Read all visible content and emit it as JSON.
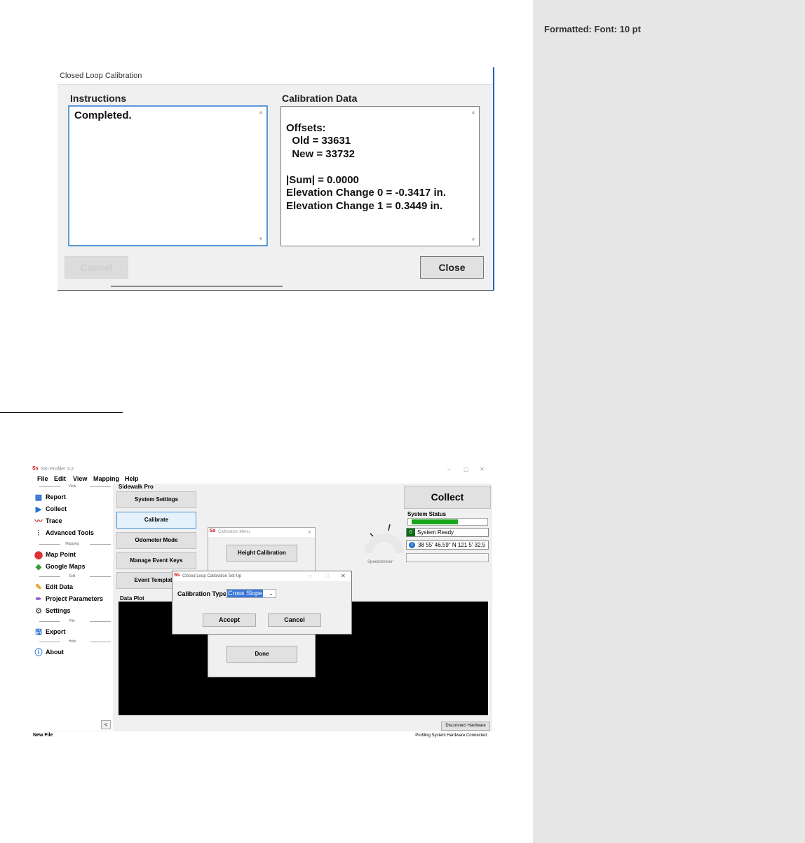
{
  "comment_pane": {
    "label": "Formatted: Font: 10 pt"
  },
  "closed_loop": {
    "title": "Closed Loop Calibration",
    "instructions_label": "Instructions",
    "instructions_text": "Completed.",
    "data_label": "Calibration Data",
    "data_lines": [
      "Offsets:",
      "  Old = 33631",
      "  New = 33732",
      "",
      "|Sum| = 0.0000",
      "Elevation Change 0 = -0.3417 in.",
      "Elevation Change 1 = 0.3449 in."
    ],
    "cancel_label": "Cancel",
    "close_label": "Close"
  },
  "app": {
    "title": "SSI Profiler 3.2",
    "window_controls": [
      "–",
      "▢",
      "✕"
    ],
    "menu": [
      "File",
      "Edit",
      "View",
      "Mapping",
      "Help"
    ],
    "sidebar": {
      "sections": [
        "View",
        "Mapping",
        "Edit",
        "File",
        "Help"
      ],
      "items": [
        {
          "label": "Report",
          "icon": "report-icon"
        },
        {
          "label": "Collect",
          "icon": "play-icon"
        },
        {
          "label": "Trace",
          "icon": "trace-icon"
        },
        {
          "label": "Advanced Tools",
          "icon": "sliders-icon"
        },
        {
          "label": "Map Point",
          "icon": "map-pin-icon"
        },
        {
          "label": "Google Maps",
          "icon": "google-maps-icon"
        },
        {
          "label": "Edit Data",
          "icon": "pencil-icon"
        },
        {
          "label": "Project Parameters",
          "icon": "pen-icon"
        },
        {
          "label": "Settings",
          "icon": "gear-icon"
        },
        {
          "label": "Export",
          "icon": "export-icon"
        },
        {
          "label": "About",
          "icon": "info-icon"
        }
      ],
      "collapse_label": "<"
    },
    "mode_label": "Sidewalk Pro",
    "side_buttons": [
      "System Settings",
      "Calibrate",
      "Odometer Mode",
      "Manage Event Keys",
      "Event Templates"
    ],
    "collect_label": "Collect",
    "system_status_label": "System Status",
    "status_progress": 0.6,
    "status_badge": "0",
    "status_text": "System Ready",
    "coordinates": "38 55' 46.59\" N 121 5' 32.5",
    "speedometer_label": "Speedometer",
    "data_plot_label": "Data Plot",
    "disconnect_label": "Disconnect Hardware",
    "statusbar_left": "New File",
    "statusbar_right": "Profiling System Hardware Connected",
    "calibration_menu": {
      "title": "Calibration Menu",
      "buttons": [
        "Height Calibration",
        "Done"
      ]
    },
    "setup_dialog": {
      "title": "Closed Loop Calibration Set-Up",
      "calibration_type_label": "Calibration Type",
      "calibration_type_value": "Cross Slope",
      "accept_label": "Accept",
      "cancel_label": "Cancel"
    }
  },
  "colors": {
    "accent_blue": "#1b62c6",
    "status_green": "#17a51b",
    "plot_bg": "#000000"
  }
}
